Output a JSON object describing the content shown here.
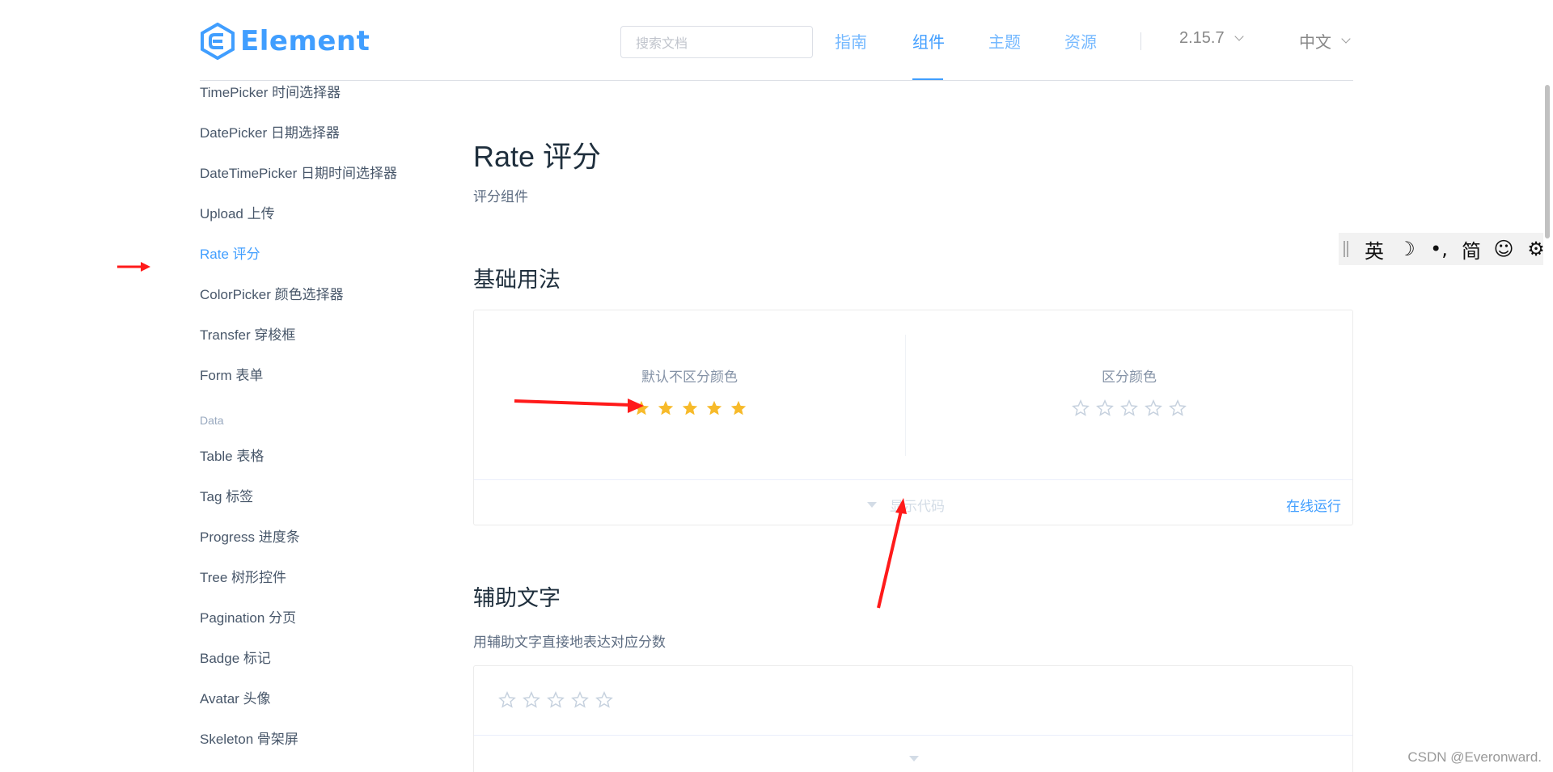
{
  "header": {
    "logo_text": "Element",
    "search_placeholder": "搜索文档",
    "nav": [
      {
        "label": "指南"
      },
      {
        "label": "组件"
      },
      {
        "label": "主题"
      },
      {
        "label": "资源"
      }
    ],
    "version": "2.15.7",
    "language": "中文"
  },
  "sidebar": {
    "items_top": [
      "TimePicker 时间选择器",
      "DatePicker 日期选择器",
      "DateTimePicker 日期时间选择器",
      "Upload 上传",
      "Rate 评分",
      "ColorPicker 颜色选择器",
      "Transfer 穿梭框",
      "Form 表单"
    ],
    "group_data": "Data",
    "items_data": [
      "Table 表格",
      "Tag 标签",
      "Progress 进度条",
      "Tree 树形控件",
      "Pagination 分页",
      "Badge 标记",
      "Avatar 头像",
      "Skeleton 骨架屏"
    ]
  },
  "main": {
    "title": "Rate 评分",
    "description": "评分组件",
    "section1": {
      "title": "基础用法",
      "demo_left_label": "默认不区分颜色",
      "demo_left_value": 5,
      "demo_right_label": "区分颜色",
      "demo_right_value": 0,
      "max_stars": 5,
      "show_code": "显示代码",
      "run_online": "在线运行"
    },
    "section2": {
      "title": "辅助文字",
      "description": "用辅助文字直接地表达对应分数",
      "demo_value": 0
    }
  },
  "ime_toolbar": {
    "items": [
      "英",
      "☽",
      "•,",
      "简",
      "☺",
      "⚙"
    ]
  },
  "watermark": "CSDN @Everonward.",
  "colors": {
    "accent": "#409eff",
    "star_filled": "#f7ba2a",
    "star_empty": "#c6d1de",
    "annotation_arrow": "#ff1a1a"
  }
}
